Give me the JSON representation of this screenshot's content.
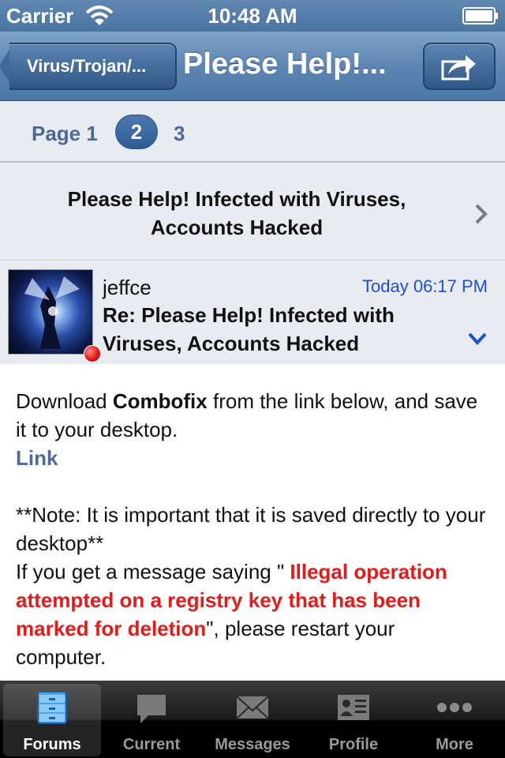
{
  "status_bar": {
    "carrier": "Carrier",
    "time": "10:48 AM"
  },
  "nav": {
    "back_label": "Virus/Trojan/...",
    "title": "Please Help!..."
  },
  "pagination": {
    "page_label": "Page 1",
    "current": "2",
    "next": "3"
  },
  "thread": {
    "title": "Please Help! Infected with Viruses, Accounts Hacked"
  },
  "post": {
    "username": "jeffce",
    "time": "Today 06:17 PM",
    "subject": "Re: Please Help! Infected with Viruses, Accounts Hacked",
    "body": {
      "line1_pre": "Download ",
      "line1_bold": "Combofix",
      "line1_post": " from the link below, and save it to your desktop.",
      "link": "Link",
      "note": "**Note:  It is important that it is saved directly to your desktop**",
      "msg_pre": "If you get a message saying \" ",
      "msg_warning": "Illegal operation attempted on a registry key that has been marked for deletion",
      "msg_post": "\", please restart your computer."
    }
  },
  "tabs": [
    {
      "label": "Forums",
      "icon": "forums-icon",
      "active": true
    },
    {
      "label": "Current",
      "icon": "current-icon"
    },
    {
      "label": "Messages",
      "icon": "messages-icon"
    },
    {
      "label": "Profile",
      "icon": "profile-icon"
    },
    {
      "label": "More",
      "icon": "more-icon"
    }
  ],
  "colors": {
    "accent": "#4c77a5",
    "link": "#1c4fd8",
    "warning": "#e51a1a"
  }
}
